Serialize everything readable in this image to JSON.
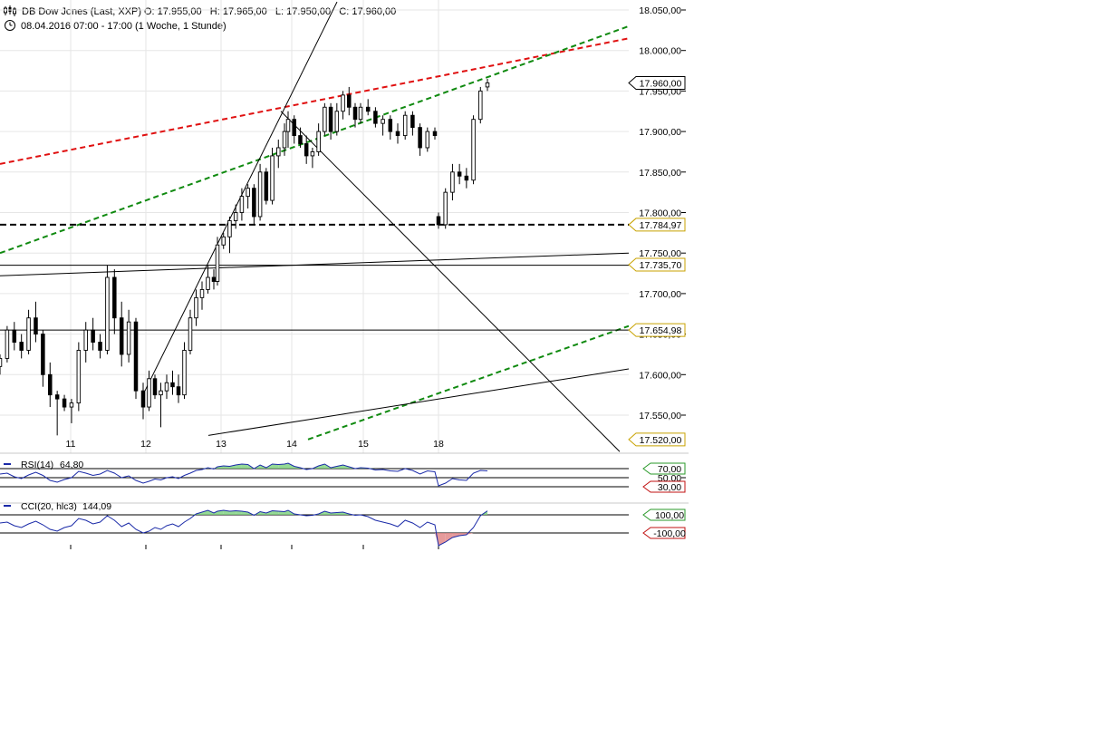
{
  "header": {
    "instrument": "DB Dow Jones (Last, XXP)",
    "ohlc": "O: 17.955,00   H: 17.965,00   L: 17.950,00   C: 17.960,00",
    "range": "08.04.2016 07:00 - 17:00 (1 Woche, 1 Stunde)",
    "icons": [
      "candlestick-chart-icon",
      "clock-icon"
    ]
  },
  "chart_data": [
    {
      "type": "candlestick",
      "title": "DB Dow Jones (Last, XXP)",
      "interval": "1 Stunde",
      "x_tick_labels": [
        "11",
        "12",
        "13",
        "14",
        "15",
        "18"
      ],
      "y_tick_labels": [
        "18.050,00",
        "18.000,00",
        "17.950,00",
        "17.900,00",
        "17.850,00",
        "17.800,00",
        "17.750,00",
        "17.700,00",
        "17.650,00",
        "17.600,00",
        "17.550,00"
      ],
      "ylim": [
        17502,
        18062
      ],
      "last_price": "17.960,00",
      "level_markers": [
        {
          "label": "17.960,00",
          "value": 17960,
          "style": "current",
          "color": "#000000"
        },
        {
          "label": "17.784,97",
          "value": 17784.97,
          "style": "dashed",
          "color": "#c8a200"
        },
        {
          "label": "17.735,70",
          "value": 17735.7,
          "style": "solid",
          "color": "#c8a200"
        },
        {
          "label": "17.654,98",
          "value": 17654.98,
          "style": "solid",
          "color": "#c8a200"
        },
        {
          "label": "17.520,00",
          "value": 17520,
          "style": "flag",
          "color": "#c8a200"
        }
      ],
      "colors": {
        "up": "#ffffff",
        "down": "#000000",
        "trend_red": "#e01010",
        "trend_green": "#108a10"
      },
      "candles": [
        {
          "day": "11",
          "o": 17610,
          "h": 17625,
          "l": 17600,
          "c": 17620
        },
        {
          "day": "11",
          "o": 17620,
          "h": 17660,
          "l": 17615,
          "c": 17655
        },
        {
          "day": "11",
          "o": 17655,
          "h": 17665,
          "l": 17630,
          "c": 17640
        },
        {
          "day": "11",
          "o": 17640,
          "h": 17650,
          "l": 17620,
          "c": 17630
        },
        {
          "day": "11",
          "o": 17630,
          "h": 17680,
          "l": 17625,
          "c": 17670
        },
        {
          "day": "11",
          "o": 17670,
          "h": 17690,
          "l": 17640,
          "c": 17650
        },
        {
          "day": "11",
          "o": 17650,
          "h": 17655,
          "l": 17585,
          "c": 17600
        },
        {
          "day": "11",
          "o": 17600,
          "h": 17615,
          "l": 17560,
          "c": 17575
        },
        {
          "day": "11",
          "o": 17575,
          "h": 17580,
          "l": 17525,
          "c": 17570
        },
        {
          "day": "11",
          "o": 17570,
          "h": 17575,
          "l": 17555,
          "c": 17560
        },
        {
          "day": "11",
          "o": 17560,
          "h": 17570,
          "l": 17540,
          "c": 17565
        },
        {
          "day": "11",
          "o": 17565,
          "h": 17640,
          "l": 17555,
          "c": 17630
        },
        {
          "day": "11",
          "o": 17630,
          "h": 17665,
          "l": 17615,
          "c": 17655
        },
        {
          "day": "11",
          "o": 17655,
          "h": 17670,
          "l": 17630,
          "c": 17640
        },
        {
          "day": "11",
          "o": 17640,
          "h": 17650,
          "l": 17620,
          "c": 17630
        },
        {
          "day": "11",
          "o": 17630,
          "h": 17735,
          "l": 17625,
          "c": 17720
        },
        {
          "day": "11",
          "o": 17720,
          "h": 17730,
          "l": 17650,
          "c": 17670
        },
        {
          "day": "11",
          "o": 17670,
          "h": 17690,
          "l": 17610,
          "c": 17625
        },
        {
          "day": "11",
          "o": 17625,
          "h": 17680,
          "l": 17615,
          "c": 17665
        },
        {
          "day": "11",
          "o": 17665,
          "h": 17670,
          "l": 17570,
          "c": 17580
        },
        {
          "day": "12",
          "o": 17580,
          "h": 17590,
          "l": 17545,
          "c": 17560
        },
        {
          "day": "12",
          "o": 17560,
          "h": 17605,
          "l": 17555,
          "c": 17595
        },
        {
          "day": "12",
          "o": 17595,
          "h": 17600,
          "l": 17570,
          "c": 17575
        },
        {
          "day": "12",
          "o": 17575,
          "h": 17590,
          "l": 17535,
          "c": 17580
        },
        {
          "day": "12",
          "o": 17580,
          "h": 17600,
          "l": 17570,
          "c": 17590
        },
        {
          "day": "12",
          "o": 17590,
          "h": 17605,
          "l": 17575,
          "c": 17585
        },
        {
          "day": "12",
          "o": 17585,
          "h": 17600,
          "l": 17565,
          "c": 17575
        },
        {
          "day": "12",
          "o": 17575,
          "h": 17640,
          "l": 17570,
          "c": 17630
        },
        {
          "day": "12",
          "o": 17630,
          "h": 17680,
          "l": 17625,
          "c": 17670
        },
        {
          "day": "12",
          "o": 17670,
          "h": 17705,
          "l": 17660,
          "c": 17695
        },
        {
          "day": "12",
          "o": 17695,
          "h": 17715,
          "l": 17680,
          "c": 17705
        },
        {
          "day": "12",
          "o": 17705,
          "h": 17735,
          "l": 17700,
          "c": 17720
        },
        {
          "day": "12",
          "o": 17720,
          "h": 17730,
          "l": 17705,
          "c": 17715
        },
        {
          "day": "13",
          "o": 17715,
          "h": 17770,
          "l": 17710,
          "c": 17760
        },
        {
          "day": "13",
          "o": 17760,
          "h": 17775,
          "l": 17755,
          "c": 17770
        },
        {
          "day": "13",
          "o": 17770,
          "h": 17795,
          "l": 17750,
          "c": 17790
        },
        {
          "day": "13",
          "o": 17790,
          "h": 17810,
          "l": 17780,
          "c": 17800
        },
        {
          "day": "13",
          "o": 17800,
          "h": 17830,
          "l": 17790,
          "c": 17820
        },
        {
          "day": "13",
          "o": 17820,
          "h": 17835,
          "l": 17805,
          "c": 17830
        },
        {
          "day": "13",
          "o": 17830,
          "h": 17835,
          "l": 17785,
          "c": 17795
        },
        {
          "day": "13",
          "o": 17795,
          "h": 17860,
          "l": 17790,
          "c": 17850
        },
        {
          "day": "13",
          "o": 17850,
          "h": 17855,
          "l": 17810,
          "c": 17815
        },
        {
          "day": "13",
          "o": 17815,
          "h": 17880,
          "l": 17810,
          "c": 17870
        },
        {
          "day": "13",
          "o": 17870,
          "h": 17890,
          "l": 17855,
          "c": 17880
        },
        {
          "day": "13",
          "o": 17880,
          "h": 17910,
          "l": 17870,
          "c": 17900
        },
        {
          "day": "14",
          "o": 17900,
          "h": 17925,
          "l": 17880,
          "c": 17915
        },
        {
          "day": "14",
          "o": 17915,
          "h": 17920,
          "l": 17885,
          "c": 17895
        },
        {
          "day": "14",
          "o": 17895,
          "h": 17905,
          "l": 17880,
          "c": 17885
        },
        {
          "day": "14",
          "o": 17885,
          "h": 17895,
          "l": 17860,
          "c": 17870
        },
        {
          "day": "14",
          "o": 17870,
          "h": 17880,
          "l": 17855,
          "c": 17875
        },
        {
          "day": "14",
          "o": 17875,
          "h": 17910,
          "l": 17870,
          "c": 17900
        },
        {
          "day": "14",
          "o": 17900,
          "h": 17935,
          "l": 17895,
          "c": 17930
        },
        {
          "day": "14",
          "o": 17930,
          "h": 17935,
          "l": 17890,
          "c": 17900
        },
        {
          "day": "14",
          "o": 17900,
          "h": 17935,
          "l": 17895,
          "c": 17925
        },
        {
          "day": "14",
          "o": 17925,
          "h": 17950,
          "l": 17915,
          "c": 17945
        },
        {
          "day": "14",
          "o": 17945,
          "h": 17955,
          "l": 17920,
          "c": 17930
        },
        {
          "day": "14",
          "o": 17930,
          "h": 17935,
          "l": 17905,
          "c": 17915
        },
        {
          "day": "15",
          "o": 17915,
          "h": 17935,
          "l": 17910,
          "c": 17930
        },
        {
          "day": "15",
          "o": 17930,
          "h": 17940,
          "l": 17920,
          "c": 17925
        },
        {
          "day": "15",
          "o": 17925,
          "h": 17930,
          "l": 17905,
          "c": 17910
        },
        {
          "day": "15",
          "o": 17910,
          "h": 17920,
          "l": 17895,
          "c": 17915
        },
        {
          "day": "15",
          "o": 17915,
          "h": 17920,
          "l": 17890,
          "c": 17900
        },
        {
          "day": "15",
          "o": 17900,
          "h": 17910,
          "l": 17885,
          "c": 17895
        },
        {
          "day": "15",
          "o": 17895,
          "h": 17925,
          "l": 17890,
          "c": 17920
        },
        {
          "day": "15",
          "o": 17920,
          "h": 17925,
          "l": 17895,
          "c": 17905
        },
        {
          "day": "15",
          "o": 17905,
          "h": 17910,
          "l": 17870,
          "c": 17880
        },
        {
          "day": "15",
          "o": 17880,
          "h": 17905,
          "l": 17875,
          "c": 17900
        },
        {
          "day": "15",
          "o": 17900,
          "h": 17905,
          "l": 17890,
          "c": 17895
        },
        {
          "day": "18",
          "o": 17795,
          "h": 17800,
          "l": 17780,
          "c": 17785
        },
        {
          "day": "18",
          "o": 17785,
          "h": 17830,
          "l": 17780,
          "c": 17825
        },
        {
          "day": "18",
          "o": 17825,
          "h": 17860,
          "l": 17815,
          "c": 17850
        },
        {
          "day": "18",
          "o": 17850,
          "h": 17860,
          "l": 17835,
          "c": 17845
        },
        {
          "day": "18",
          "o": 17845,
          "h": 17855,
          "l": 17830,
          "c": 17840
        },
        {
          "day": "18",
          "o": 17840,
          "h": 17920,
          "l": 17835,
          "c": 17915
        },
        {
          "day": "18",
          "o": 17915,
          "h": 17955,
          "l": 17910,
          "c": 17950
        },
        {
          "day": "18",
          "o": 17955,
          "h": 17965,
          "l": 17950,
          "c": 17960
        }
      ]
    },
    {
      "type": "line",
      "indicator": "RSI",
      "label": "RSI(14)",
      "value_text": "64,80",
      "ylim": [
        0,
        100
      ],
      "levels": [
        {
          "label": "70,00",
          "value": 70
        },
        {
          "label": "50,00",
          "value": 50
        },
        {
          "label": "30,00",
          "value": 30
        }
      ],
      "color": "#1a2aa8",
      "values": [
        58,
        60,
        52,
        48,
        56,
        62,
        55,
        44,
        40,
        46,
        50,
        64,
        60,
        55,
        58,
        66,
        60,
        50,
        54,
        44,
        38,
        42,
        47,
        45,
        50,
        52,
        48,
        55,
        60,
        66,
        68,
        72,
        69,
        74,
        76,
        75,
        78,
        80,
        79,
        70,
        78,
        72,
        80,
        79,
        80,
        82,
        75,
        72,
        68,
        70,
        76,
        80,
        72,
        75,
        78,
        74,
        70,
        72,
        71,
        67,
        68,
        65,
        64,
        70,
        66,
        58,
        65,
        63,
        32,
        38,
        48,
        45,
        44,
        60,
        66,
        65
      ]
    },
    {
      "type": "line",
      "indicator": "CCI",
      "label": "CCI(20, hlc3)",
      "value_text": "144,09",
      "ylim": [
        -300,
        300
      ],
      "levels": [
        {
          "label": "100,00",
          "value": 100
        },
        {
          "label": "-100,00",
          "value": -100
        }
      ],
      "color": "#1a2aa8",
      "values": [
        10,
        20,
        -20,
        -40,
        0,
        30,
        -10,
        -60,
        -80,
        -40,
        -20,
        60,
        40,
        0,
        20,
        90,
        40,
        -30,
        10,
        -60,
        -100,
        -80,
        -40,
        -60,
        -20,
        0,
        -30,
        20,
        60,
        110,
        130,
        150,
        120,
        140,
        150,
        140,
        145,
        140,
        130,
        95,
        135,
        120,
        145,
        140,
        135,
        150,
        110,
        100,
        90,
        95,
        110,
        140,
        120,
        125,
        130,
        110,
        95,
        100,
        80,
        40,
        20,
        0,
        -30,
        40,
        10,
        -40,
        20,
        -10,
        -240,
        -200,
        -150,
        -130,
        -120,
        -40,
        90,
        144
      ]
    }
  ]
}
